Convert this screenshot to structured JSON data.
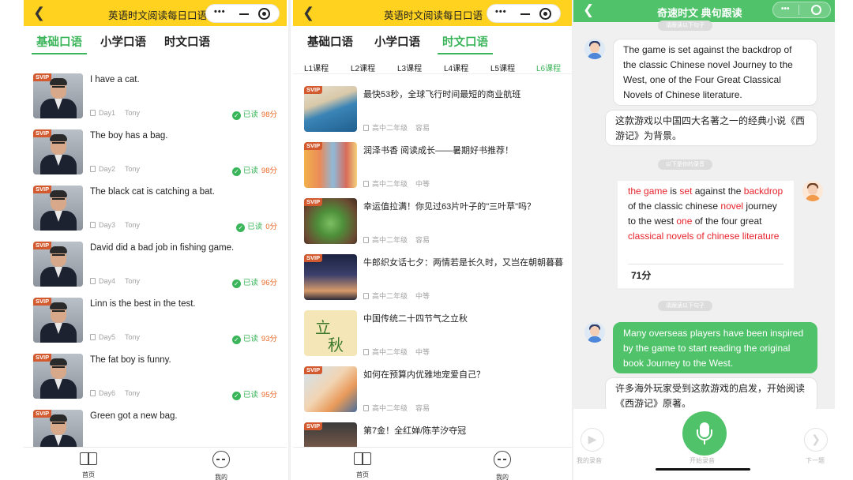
{
  "colors": {
    "accent_green": "#3bb55a",
    "brand_yellow": "#ffd21f",
    "score_orange": "#e86a2a",
    "svip_badge": "#d35a2f",
    "highlight_red": "#e8232c"
  },
  "panel1": {
    "title": "英语时文阅读每日口语",
    "tabs": [
      "基础口语",
      "小学口语",
      "时文口语"
    ],
    "active_tab": 0,
    "items": [
      {
        "badge": "SVIP",
        "sentence": "I have a cat.",
        "day": "Day1",
        "teacher": "Tony",
        "status": "已读",
        "score": "98分"
      },
      {
        "badge": "SVIP",
        "sentence": "The boy has a bag.",
        "day": "Day2",
        "teacher": "Tony",
        "status": "已读",
        "score": "98分"
      },
      {
        "badge": "SVIP",
        "sentence": "The black cat is catching a bat.",
        "day": "Day3",
        "teacher": "Tony",
        "status": "已读",
        "score": "0分"
      },
      {
        "badge": "SVIP",
        "sentence": "David did a bad job in fishing game.",
        "day": "Day4",
        "teacher": "Tony",
        "status": "已读",
        "score": "96分"
      },
      {
        "badge": "SVIP",
        "sentence": "Linn is the best in the test.",
        "day": "Day5",
        "teacher": "Tony",
        "status": "已读",
        "score": "93分"
      },
      {
        "badge": "SVIP",
        "sentence": "The fat boy is funny.",
        "day": "Day6",
        "teacher": "Tony",
        "status": "已读",
        "score": "95分"
      },
      {
        "badge": "SVIP",
        "sentence": "Green got a new bag."
      }
    ],
    "nav": {
      "home": "首页",
      "mine": "我的"
    }
  },
  "panel2": {
    "title": "英语时文阅读每日口语",
    "tabs": [
      "基础口语",
      "小学口语",
      "时文口语"
    ],
    "active_tab": 2,
    "lessons": [
      "L1课程",
      "L2课程",
      "L3课程",
      "L4课程",
      "L5课程",
      "L6课程"
    ],
    "active_lesson": 5,
    "items": [
      {
        "badge": "SVIP",
        "title": "最快53秒，全球飞行时间最短的商业航班",
        "grade": "高中二年级",
        "level": "容易"
      },
      {
        "badge": "SVIP",
        "title": "润泽书香 阅读成长——暑期好书推荐！",
        "grade": "高中二年级",
        "level": "中等"
      },
      {
        "badge": "SVIP",
        "title": "幸运值拉满！你见过63片叶子的\"三叶草\"吗？",
        "grade": "高中二年级",
        "level": "容易"
      },
      {
        "badge": "SVIP",
        "title": "牛郎织女话七夕：两情若是长久时，又岂在朝朝暮暮",
        "grade": "高中二年级",
        "level": "中等"
      },
      {
        "badge": "",
        "title": "中国传统二十四节气之立秋",
        "grade": "高中二年级",
        "level": "中等",
        "pic_chars": [
          "立",
          "秋"
        ]
      },
      {
        "badge": "SVIP",
        "title": "如何在预算内优雅地宠爱自己？",
        "grade": "高中二年级",
        "level": "容易"
      },
      {
        "badge": "SVIP",
        "title": "第7金！全红婵/陈芋汐夺冠"
      }
    ],
    "nav": {
      "home": "首页",
      "mine": "我的"
    }
  },
  "panel3": {
    "title": "奇速时文 典句跟读",
    "hint_top": "请跟读以下句子",
    "hint_mid": "以下是你的录音",
    "hint_low": "请跟读以下句子",
    "msg1_en": "The game is set against the backdrop of the classic Chinese novel Journey to the West, one of the Four Great Classical Novels of Chinese literature.",
    "msg1_cn": "这款游戏以中国四大名著之一的经典小说《西游记》为背景。",
    "recording": {
      "words": [
        {
          "t": "the game",
          "red": true
        },
        {
          "t": " is ",
          "red": false
        },
        {
          "t": "set",
          "red": true
        },
        {
          "t": " against the ",
          "red": false
        },
        {
          "t": "backdrop",
          "red": true
        },
        {
          "t": " of the classic chinese ",
          "red": false
        },
        {
          "t": "novel",
          "red": true
        },
        {
          "t": " journey to the west ",
          "red": false
        },
        {
          "t": "one",
          "red": true
        },
        {
          "t": " of the four great ",
          "red": false
        },
        {
          "t": "classical novels of chinese literature",
          "red": true
        }
      ],
      "score": "71分"
    },
    "msg2_en": "Many overseas players have been inspired by the game to start reading the original book Journey to the West.",
    "msg2_cn": "许多海外玩家受到这款游戏的启发，开始阅读《西游记》原著。",
    "controls": {
      "my_recording": "我的录音",
      "start_recording": "开始录音",
      "next": "下一题"
    }
  }
}
